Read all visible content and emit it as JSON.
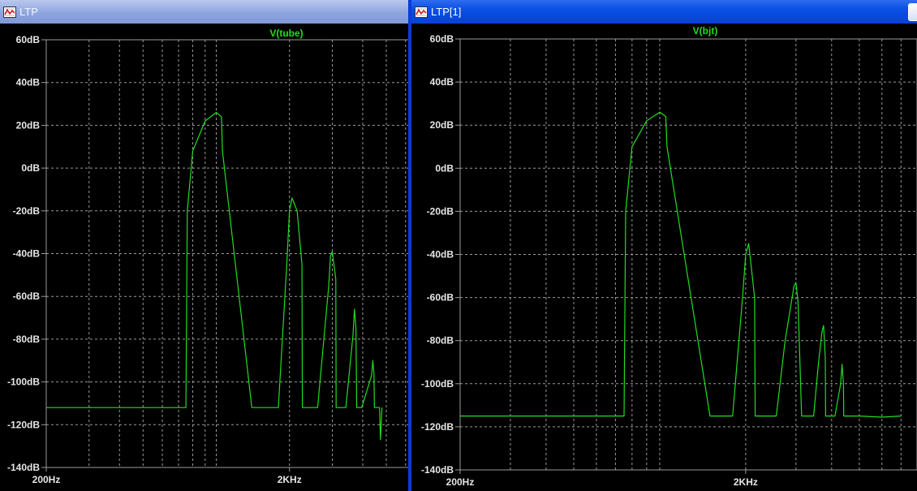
{
  "windows": [
    {
      "title": "LTP",
      "trace_label": "V(tube)",
      "colors": {
        "trace": "#22dd22",
        "grid": "#9a9a9a",
        "axis_text": "#e6e6e6"
      },
      "y_ticks": [
        "60dB",
        "40dB",
        "20dB",
        "0dB",
        "-20dB",
        "-40dB",
        "-60dB",
        "-80dB",
        "-100dB",
        "-120dB",
        "-140dB"
      ],
      "x_ticks": [
        "200Hz",
        "2KHz"
      ]
    },
    {
      "title": "LTP[1]",
      "trace_label": "V(bjt)",
      "colors": {
        "trace": "#22dd22",
        "grid": "#9a9a9a",
        "axis_text": "#e6e6e6"
      },
      "y_ticks": [
        "60dB",
        "40dB",
        "20dB",
        "0dB",
        "-20dB",
        "-40dB",
        "-60dB",
        "-80dB",
        "-100dB",
        "-120dB",
        "-140dB"
      ],
      "x_ticks": [
        "200Hz",
        "2KHz"
      ]
    }
  ],
  "chart_data": [
    {
      "type": "line",
      "title": "V(tube)",
      "xlabel": "",
      "ylabel": "",
      "x_scale": "log",
      "ylim": [
        -140,
        60
      ],
      "series": [
        {
          "name": "V(tube)",
          "x": [
            200,
            750,
            760,
            800,
            900,
            1000,
            1050,
            1060,
            1400,
            1410,
            1600,
            1800,
            1950,
            2000,
            2050,
            2150,
            2250,
            2260,
            2600,
            2610,
            2900,
            2950,
            3000,
            3100,
            3110,
            3400,
            3410,
            3650,
            3700,
            3750,
            3780,
            3950,
            3960,
            4350,
            4400,
            4450,
            4470,
            4690,
            4730,
            4800
          ],
          "y": [
            -112,
            -112,
            -20,
            8,
            22,
            26,
            24,
            8,
            -112,
            -112,
            -112,
            -112,
            -45,
            -20,
            -14,
            -20,
            -45,
            -112,
            -112,
            -112,
            -55,
            -41,
            -39,
            -52,
            -112,
            -112,
            -112,
            -78,
            -66,
            -75,
            -112,
            -112,
            -112,
            -97,
            -90,
            -96,
            -112,
            -112,
            -127,
            -112
          ]
        }
      ]
    },
    {
      "type": "line",
      "title": "V(bjt)",
      "xlabel": "",
      "ylabel": "",
      "x_scale": "log",
      "ylim": [
        -140,
        60
      ],
      "series": [
        {
          "name": "V(bjt)",
          "x": [
            200,
            750,
            760,
            800,
            900,
            1000,
            1050,
            1060,
            1500,
            1510,
            1800,
            1950,
            2000,
            2050,
            2150,
            2160,
            2550,
            2560,
            2750,
            2950,
            3000,
            3050,
            3140,
            3150,
            3450,
            3460,
            3600,
            3700,
            3750,
            3800,
            3810,
            4100,
            4110,
            4300,
            4350,
            4400,
            4410,
            5000,
            6000,
            7000
          ],
          "y": [
            -115,
            -115,
            -20,
            10,
            22,
            26,
            24,
            10,
            -115,
            -115,
            -115,
            -60,
            -40,
            -35,
            -60,
            -115,
            -115,
            -115,
            -80,
            -55,
            -53,
            -62,
            -115,
            -115,
            -115,
            -115,
            -90,
            -76,
            -73,
            -88,
            -115,
            -115,
            -115,
            -100,
            -91,
            -100,
            -115,
            -115,
            -115.5,
            -115
          ]
        }
      ]
    }
  ]
}
